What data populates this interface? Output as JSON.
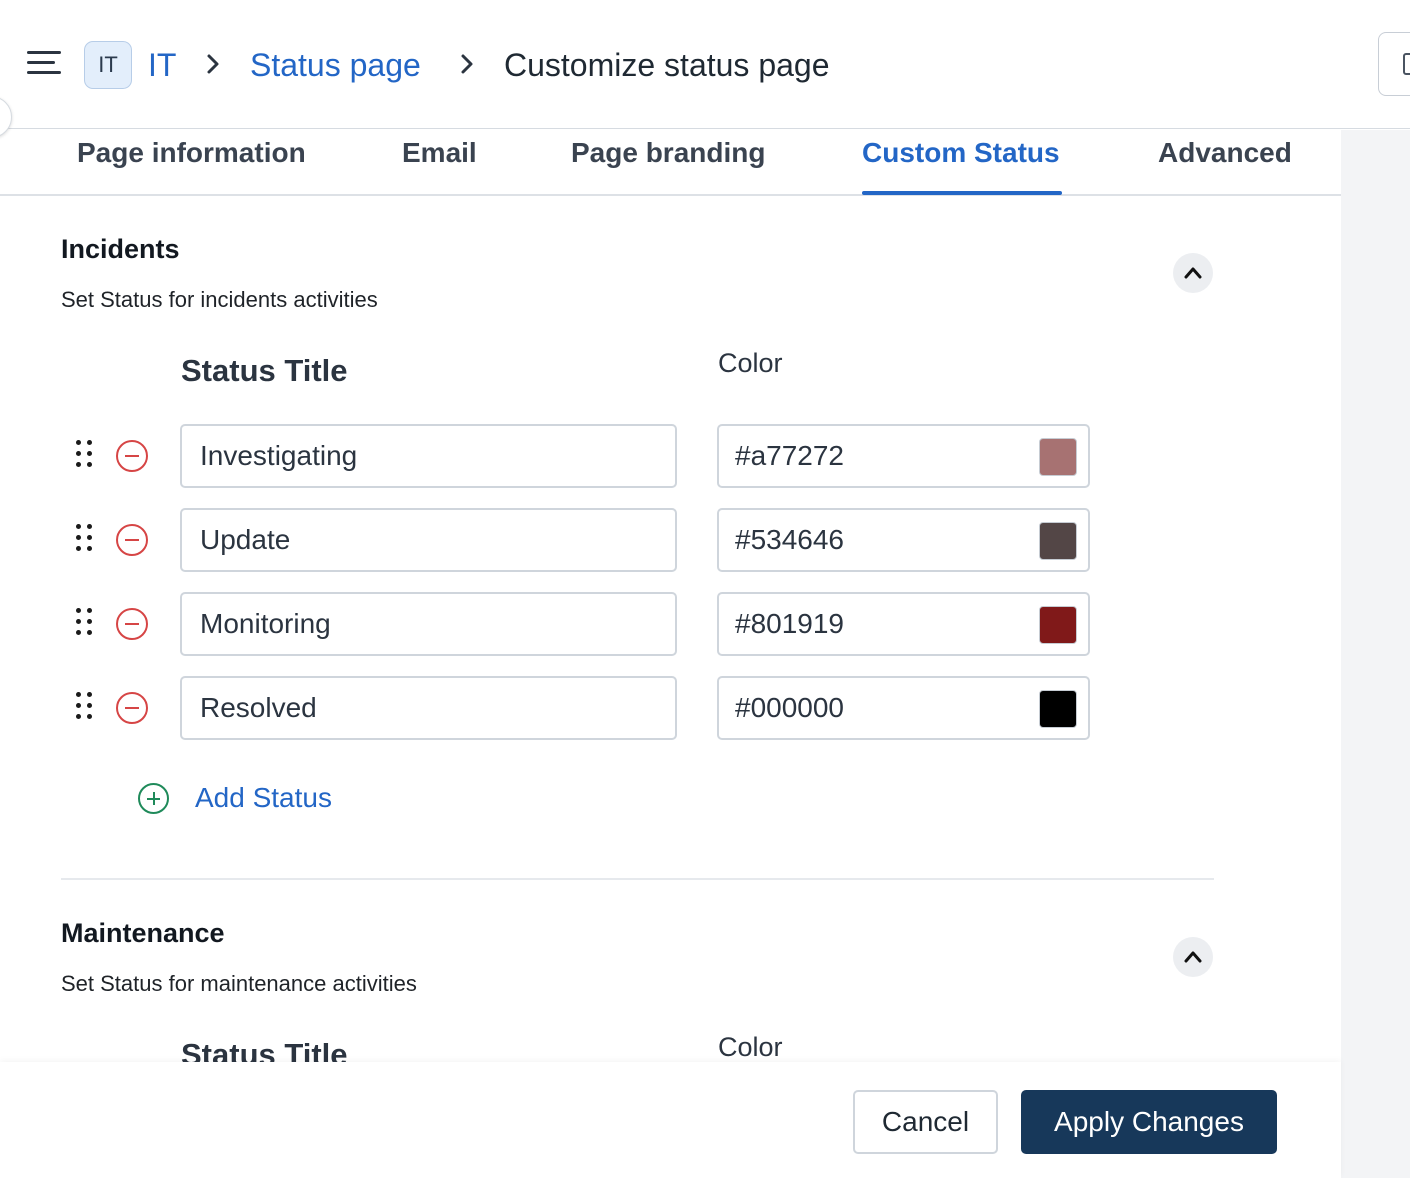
{
  "header": {
    "menu_icon": "hamburger-menu-icon",
    "workspace_badge": "IT",
    "breadcrumb": {
      "workspace": "IT",
      "section": "Status page",
      "current": "Customize status page"
    },
    "separator_icon": "chevron-right-icon"
  },
  "tabs": [
    {
      "label": "Page information",
      "active": false
    },
    {
      "label": "Email",
      "active": false
    },
    {
      "label": "Page branding",
      "active": false
    },
    {
      "label": "Custom Status",
      "active": true
    },
    {
      "label": "Advanced",
      "active": false
    }
  ],
  "accent_color": "#2366c6",
  "incidents": {
    "title": "Incidents",
    "subtitle": "Set Status for incidents activities",
    "column_title": "Status Title",
    "column_color": "Color",
    "statuses": [
      {
        "title": "Investigating",
        "color": "#a77272"
      },
      {
        "title": "Update",
        "color": "#534646"
      },
      {
        "title": "Monitoring",
        "color": "#801919"
      },
      {
        "title": "Resolved",
        "color": "#000000"
      }
    ],
    "add_label": "Add Status"
  },
  "maintenance": {
    "title": "Maintenance",
    "subtitle": "Set Status for maintenance activities",
    "column_title": "Status Title",
    "column_color": "Color"
  },
  "footer": {
    "cancel_label": "Cancel",
    "apply_label": "Apply Changes",
    "apply_color": "#17385a"
  }
}
